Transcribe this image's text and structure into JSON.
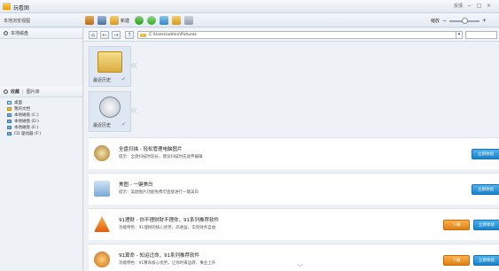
{
  "titlebar": {
    "title": "玩看图",
    "right_link": "反馈"
  },
  "toolbar": {
    "left_link": "本地浏览视图",
    "tool_label": "新建",
    "zoom_label": "缩放"
  },
  "sidebar": {
    "top_item": "本地磁盘",
    "section_title": "收藏",
    "section_tab": "图片库",
    "items": [
      {
        "label": "桌面",
        "icon": "desktop-icon"
      },
      {
        "label": "我的文档",
        "icon": "documents-icon"
      },
      {
        "label": "本地磁盘 (C:)",
        "icon": "drive-icon"
      },
      {
        "label": "本地磁盘 (D:)",
        "icon": "drive-icon"
      },
      {
        "label": "本地磁盘 (E:)",
        "icon": "drive-icon"
      },
      {
        "label": "CD 驱动器 (F:)",
        "icon": "cd-icon"
      }
    ]
  },
  "address": {
    "path": "C:\\Users\\admin\\Pictures"
  },
  "thumbs": [
    {
      "label": "最近历史",
      "icon": "folder-icon"
    },
    {
      "label": "最近历史",
      "icon": "clock-icon"
    }
  ],
  "features": [
    {
      "title": "全盘扫描 - 轻松管理电脑图片",
      "desc": "提示：全盘扫描时较长，建议扫描时先放弃编辑",
      "btn1": "立即体验",
      "btn2": "",
      "icon": "magnifier-icon"
    },
    {
      "title": "美图 - 一键美白",
      "desc": "提示：美颜图片功能免费可直接进行一键美白",
      "btn1": "立即体验",
      "btn2": "",
      "icon": "beauty-icon"
    },
    {
      "title": "91理财 - 你不理财财不理你，91系列推荐软件",
      "desc": "功能特色：91理财的核心优势，高收益，实现财务自由",
      "btn1": "下载",
      "btn2": "立即体验",
      "icon": "finance-icon"
    },
    {
      "title": "91算命 - 知运过命，91系列推荐软件",
      "desc": "功能特色：91算命核心优势，让你时来运转，事业上升",
      "btn1": "下载",
      "btn2": "立即体验",
      "icon": "fortune-icon"
    }
  ],
  "colors": {
    "accent_blue": "#1b82c9",
    "accent_orange": "#e07f14"
  }
}
